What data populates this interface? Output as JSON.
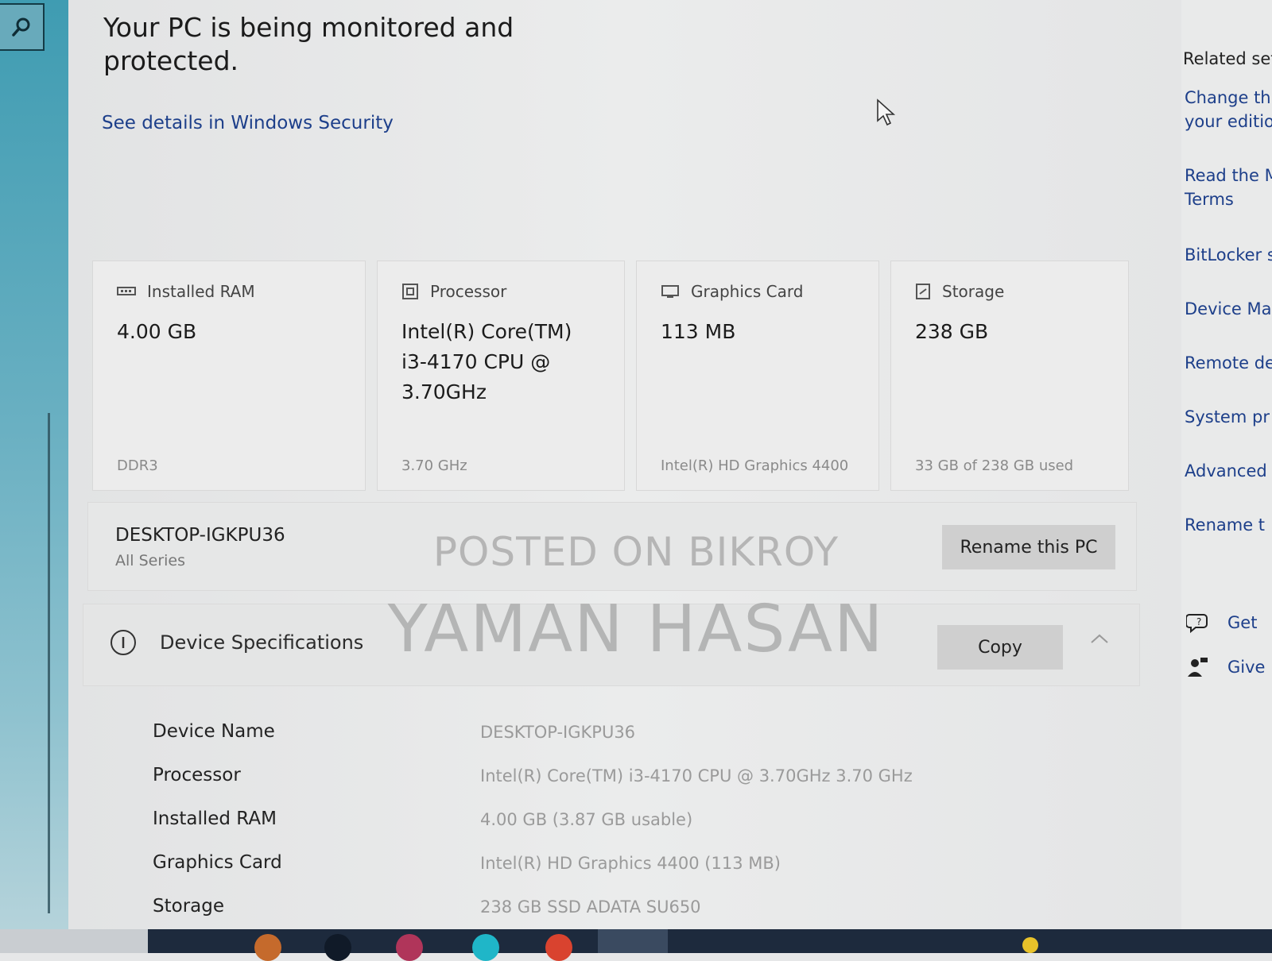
{
  "security": {
    "headline": "Your PC is being monitored and protected.",
    "link": "See details in Windows Security"
  },
  "cards": [
    {
      "icon": "ram-icon",
      "title": "Installed RAM",
      "value": "4.00 GB",
      "sub": "DDR3"
    },
    {
      "icon": "processor-icon",
      "title": "Processor",
      "value": "Intel(R) Core(TM) i3-4170 CPU @ 3.70GHz",
      "sub": "3.70 GHz"
    },
    {
      "icon": "graphics-card-icon",
      "title": "Graphics Card",
      "value": "113 MB",
      "sub": "Intel(R) HD Graphics 4400"
    },
    {
      "icon": "storage-icon",
      "title": "Storage",
      "value": "238 GB",
      "sub": "33 GB of 238 GB used"
    }
  ],
  "pc": {
    "name": "DESKTOP-IGKPU36",
    "model": "All Series",
    "rename_label": "Rename this PC"
  },
  "specs": {
    "title": "Device Specifications",
    "copy_label": "Copy",
    "rows": [
      {
        "label": "Device Name",
        "value": "DESKTOP-IGKPU36"
      },
      {
        "label": "Processor",
        "value": "Intel(R) Core(TM) i3-4170 CPU @ 3.70GHz   3.70 GHz"
      },
      {
        "label": "Installed RAM",
        "value": "4.00 GB (3.87 GB usable)"
      },
      {
        "label": "Graphics Card",
        "value": "Intel(R) HD Graphics 4400 (113 MB)"
      },
      {
        "label": "Storage",
        "value": "238 GB SSD ADATA SU650"
      }
    ]
  },
  "related": {
    "title": "Related set",
    "links": [
      {
        "text": "Change th",
        "text2": "your editio"
      },
      {
        "text": "Read the M",
        "text2": "Terms"
      },
      {
        "text": "BitLocker s"
      },
      {
        "text": "Device Ma"
      },
      {
        "text": "Remote de"
      },
      {
        "text": "System pr"
      },
      {
        "text": "Advanced"
      },
      {
        "text": "Rename t"
      }
    ],
    "help": [
      {
        "icon": "get-help-icon",
        "text": "Get"
      },
      {
        "icon": "give-feedback-icon",
        "text": "Give"
      }
    ]
  },
  "watermark": {
    "line1": "POSTED ON BIKROY",
    "line2": "YAMAN HASAN"
  },
  "colors": {
    "link": "#1d3f8a",
    "taskbar": "#1d2a3d",
    "button": "#cfcfcf"
  }
}
